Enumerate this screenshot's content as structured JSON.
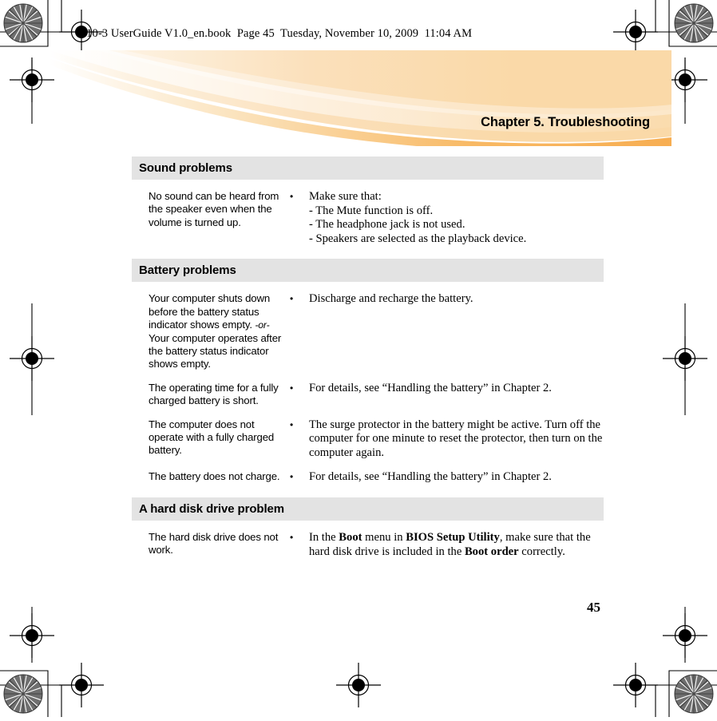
{
  "print": {
    "file_header": "S10-3 UserGuide V1.0_en.book  Page 45  Tuesday, November 10, 2009  11:04 AM",
    "registration_mark_name": "registration-target",
    "halftone_mark_name": "halftone-star"
  },
  "banner": {
    "chapter_title": "Chapter 5. Troubleshooting",
    "color_light": "#fdf0dc",
    "color_main": "#fad9a8",
    "color_accent": "#f7ae52"
  },
  "colors": {
    "section_header_bg": "#e3e3e3",
    "text": "#000000",
    "page_bg": "#ffffff"
  },
  "sections": [
    {
      "heading": "Sound problems",
      "rows": [
        {
          "problem_lines": [
            "No sound can be heard from the speaker even when the volume is turned up."
          ],
          "bullet": "•",
          "answer_lead": "Make sure that:",
          "answer_sub": [
            "-  The Mute function is off.",
            "-  The headphone jack is not used.",
            "-  Speakers are selected as the playback device."
          ]
        }
      ]
    },
    {
      "heading": "Battery problems",
      "rows": [
        {
          "problem_lines": [
            "Your computer shuts down before the battery status indicator shows empty."
          ],
          "problem_or": "-or-",
          "problem_lines2": [
            "Your computer operates after the battery status indicator shows empty."
          ],
          "bullet": "•",
          "answer_lead": "Discharge and recharge the battery.",
          "answer_sub": []
        },
        {
          "problem_lines": [
            "The operating time for a fully charged battery is short."
          ],
          "bullet": "•",
          "answer_lead": "For details, see “Handling the battery” in Chapter 2.",
          "answer_sub": []
        },
        {
          "problem_lines": [
            "The computer does not operate with a fully charged battery."
          ],
          "bullet": "•",
          "answer_lead": "The surge protector in the battery might be active. Turn off the computer for one minute to reset the protector, then turn on the computer again.",
          "answer_sub": []
        },
        {
          "problem_lines": [
            "The battery does not charge."
          ],
          "bullet": "•",
          "answer_lead": "For details, see “Handling the battery” in Chapter 2.",
          "answer_sub": []
        }
      ]
    },
    {
      "heading": "A hard disk drive problem",
      "rows": [
        {
          "problem_lines": [
            "The hard disk drive does not work."
          ],
          "bullet": "•",
          "answer_rich": {
            "p1": "In the ",
            "b1": "Boot",
            "p2": " menu in ",
            "b2": "BIOS Setup Utility",
            "p3": ", make sure that the hard disk drive is included in the ",
            "b3": "Boot order",
            "p4": " correctly."
          }
        }
      ]
    }
  ],
  "footer": {
    "page_number": "45"
  }
}
